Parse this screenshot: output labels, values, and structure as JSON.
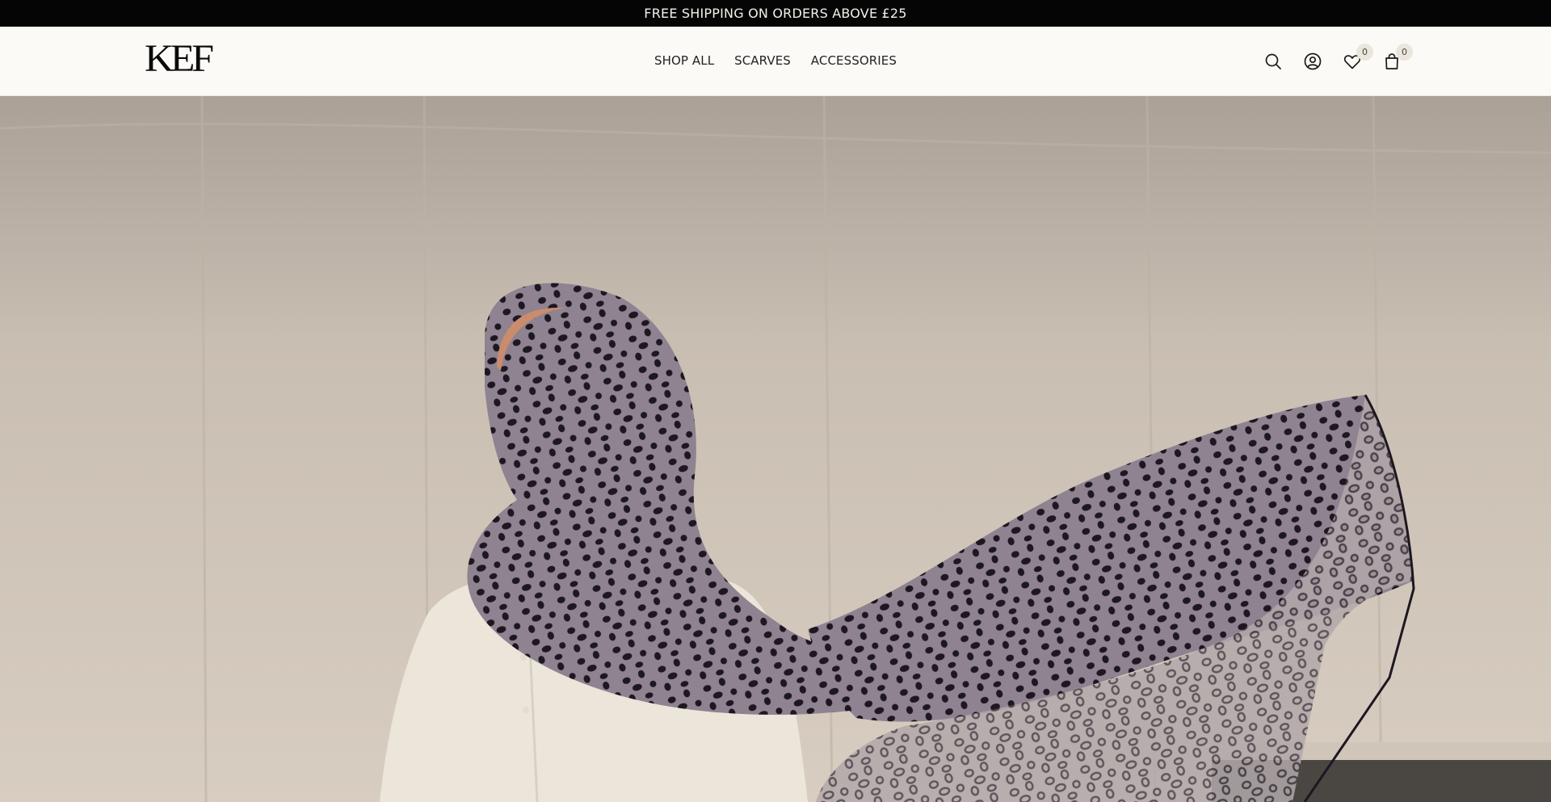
{
  "announcement": {
    "text": "FREE SHIPPING ON ORDERS ABOVE £25"
  },
  "header": {
    "logo": "KEF",
    "nav": [
      {
        "label": "SHOP ALL"
      },
      {
        "label": "SCARVES"
      },
      {
        "label": "ACCESSORIES"
      }
    ],
    "icons": {
      "search": "search-icon",
      "account": "account-icon",
      "wishlist": "heart-icon",
      "cart": "shopping-bag-icon"
    },
    "wishlist_count": "0",
    "cart_count": "0"
  },
  "colors": {
    "announcement_bg": "#050505",
    "header_bg": "#fbfaf7",
    "scarf": "#8f8391",
    "spots": "#1c1720",
    "shirt": "#ece6da"
  }
}
